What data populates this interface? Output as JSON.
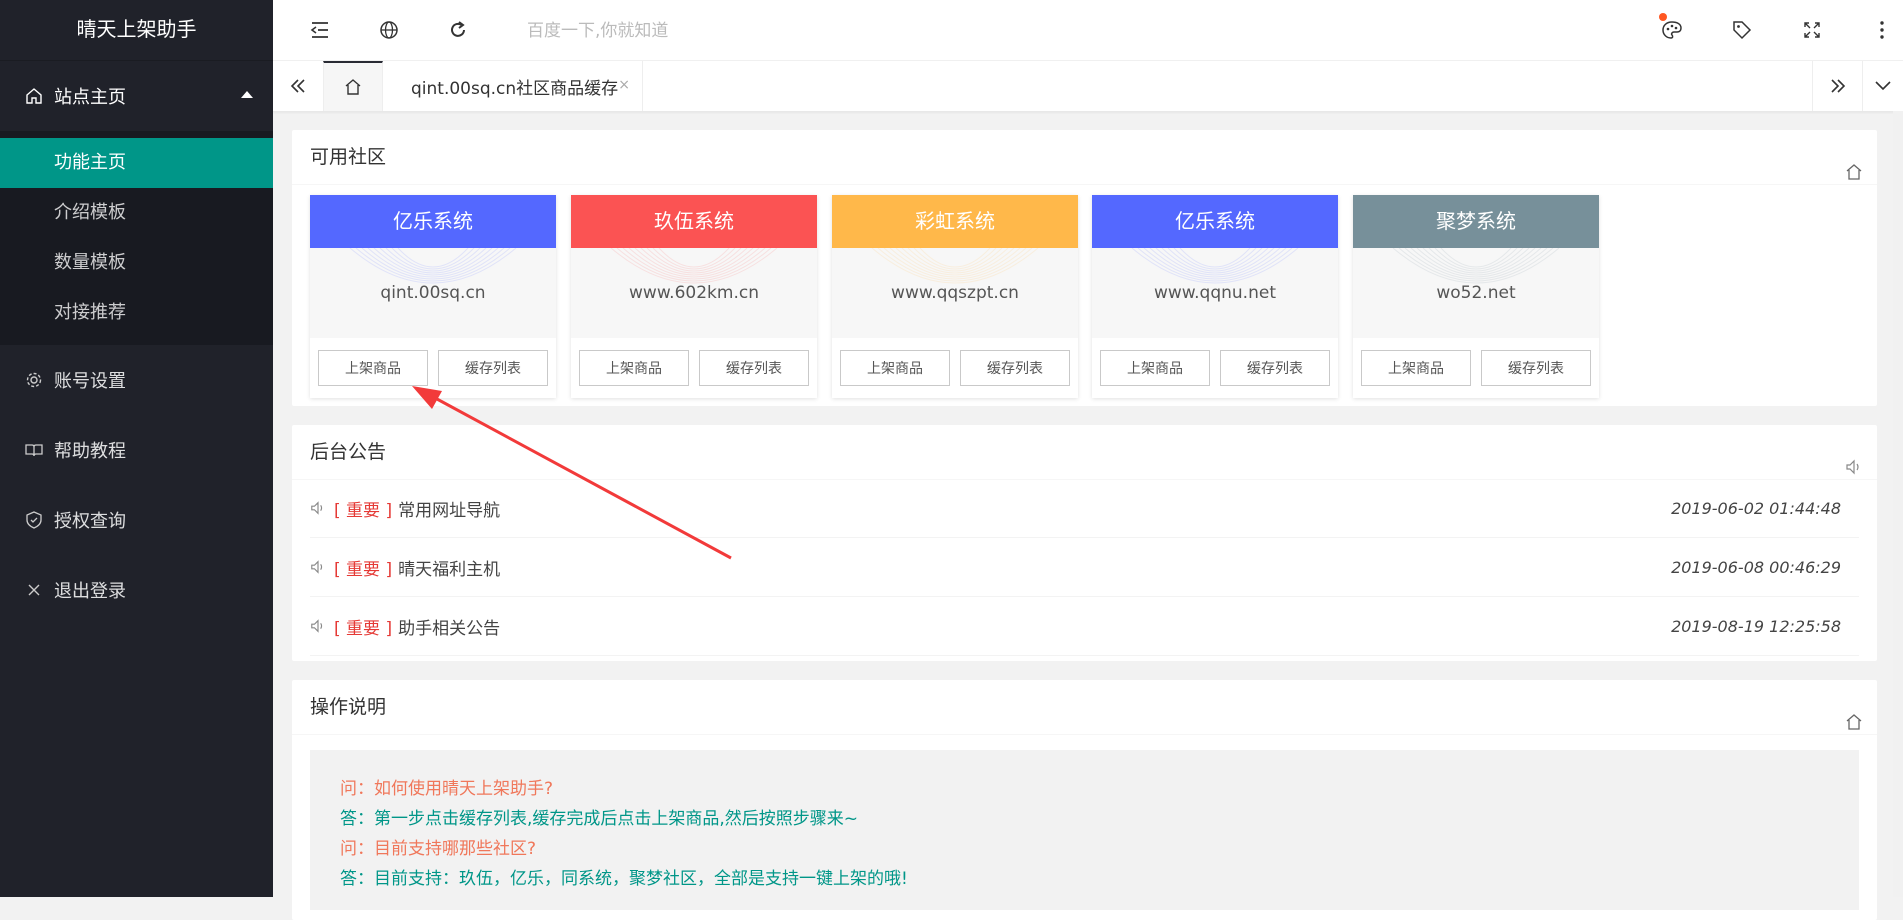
{
  "app": {
    "title": "晴天上架助手"
  },
  "sidebar": {
    "home": {
      "label": "站点主页",
      "icon": "home-icon"
    },
    "sub_items": [
      {
        "label": "功能主页",
        "active": true
      },
      {
        "label": "介绍模板"
      },
      {
        "label": "数量模板"
      },
      {
        "label": "对接推荐"
      }
    ],
    "items": [
      {
        "label": "账号设置",
        "icon": "gear-icon"
      },
      {
        "label": "帮助教程",
        "icon": "book-icon"
      },
      {
        "label": "授权查询",
        "icon": "shield-icon"
      },
      {
        "label": "退出登录",
        "icon": "close-icon"
      }
    ]
  },
  "header": {
    "search_placeholder": "百度一下,你就知道",
    "icons": [
      "menu-toggle-icon",
      "globe-icon",
      "refresh-icon",
      "palette-icon",
      "tag-icon",
      "fullscreen-icon",
      "more-vertical-icon"
    ]
  },
  "tabs": {
    "current": "qint.00sq.cn社区商品缓存",
    "close": "×"
  },
  "communities": {
    "title": "可用社区",
    "items": [
      {
        "name": "亿乐系统",
        "url": "qint.00sq.cn",
        "color": "#5468ff"
      },
      {
        "name": "玖伍系统",
        "url": "www.602km.cn",
        "color": "#fb5353"
      },
      {
        "name": "彩虹系统",
        "url": "www.qqszpt.cn",
        "color": "#ffb84a"
      },
      {
        "name": "亿乐系统",
        "url": "www.qqnu.net",
        "color": "#5468ff"
      },
      {
        "name": "聚梦系统",
        "url": "wo52.net",
        "color": "#77909a"
      }
    ],
    "btn_list": "上架商品",
    "btn_cache": "缓存列表"
  },
  "notices": {
    "title": "后台公告",
    "items": [
      {
        "tag": "[ 重要 ]",
        "title": "常用网址导航",
        "time": "2019-06-02 01:44:48"
      },
      {
        "tag": "[ 重要 ]",
        "title": "晴天福利主机",
        "time": "2019-06-08 00:46:29"
      },
      {
        "tag": "[ 重要 ]",
        "title": "助手相关公告",
        "time": "2019-08-19 12:25:58"
      }
    ]
  },
  "guide": {
    "title": "操作说明",
    "lines": [
      {
        "type": "q",
        "text": "问：如何使用晴天上架助手?"
      },
      {
        "type": "a",
        "text": "答：第一步点击缓存列表,缓存完成后点击上架商品,然后按照步骤来~"
      },
      {
        "type": "q",
        "text": "问：目前支持哪那些社区?"
      },
      {
        "type": "a",
        "text": "答：目前支持：玖伍，亿乐，同系统，聚梦社区，全部是支持一键上架的哦!"
      }
    ]
  }
}
